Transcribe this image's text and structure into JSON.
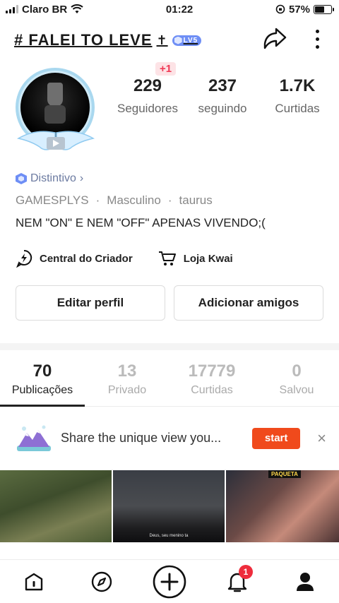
{
  "status_bar": {
    "carrier": "Claro BR",
    "time": "01:22",
    "battery_percent": "57%",
    "battery_level": 0.57
  },
  "header": {
    "username": "# FALEI TO LEVE",
    "cross_symbol": "✝",
    "level_badge": "LV5"
  },
  "stats": {
    "new_followers": "+1",
    "items": [
      {
        "value": "229",
        "label": "Seguidores"
      },
      {
        "value": "237",
        "label": "seguindo"
      },
      {
        "value": "1.7K",
        "label": "Curtidas"
      }
    ]
  },
  "profile": {
    "badge_label": "Distintivo",
    "badge_chevron": "›",
    "tags": [
      "GAMESPLYS",
      "Masculino",
      "taurus"
    ],
    "tag_separator": "·",
    "bio": "NEM \"ON\" E NEM \"OFF\" APENAS VIVENDO;("
  },
  "links": {
    "creator_center": "Central do Criador",
    "shop": "Loja Kwai"
  },
  "buttons": {
    "edit_profile": "Editar perfil",
    "add_friends": "Adicionar amigos"
  },
  "tabs": [
    {
      "count": "70",
      "label": "Publicações"
    },
    {
      "count": "13",
      "label": "Privado"
    },
    {
      "count": "17779",
      "label": "Curtidas"
    },
    {
      "count": "0",
      "label": "Salvou"
    }
  ],
  "banner": {
    "text": "Share the unique view you...",
    "start_label": "start",
    "close_label": "×"
  },
  "videos": {
    "thumb2_caption": "Deus, seu menino ta",
    "thumb3_sticker": "PAQUETA"
  },
  "bottom_nav": {
    "notification_count": "1"
  },
  "colors": {
    "accent": "#f04a1c",
    "badge_red": "#ee2c3c",
    "level_blue": "#6e8ef5"
  }
}
